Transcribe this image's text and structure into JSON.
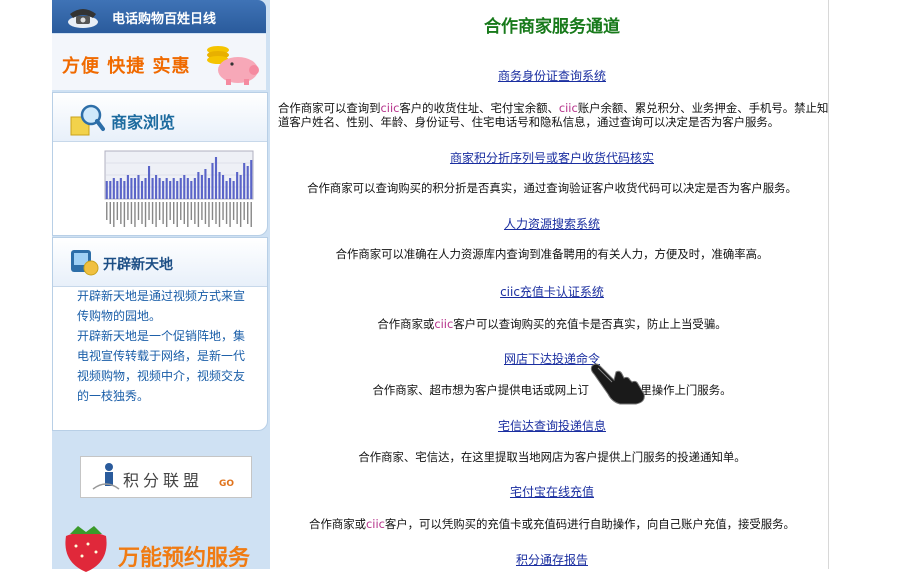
{
  "sidebar": {
    "hotline_title": "电话购物百姓日线",
    "slogan": "方便 快捷 实惠",
    "browse_title": "商家浏览",
    "new_world_title": "开辟新天地",
    "new_world_desc": [
      "开辟新天地是通过视频方式来宣传购物的园地。",
      "开辟新天地是一个促销阵地，集电视宣传转载于网络，是新一代视频购物，视频中介，视频交友的一枝独秀。"
    ],
    "points_alliance": "积分联盟",
    "points_go": "GO",
    "booking_service": "万能预约服务"
  },
  "main": {
    "title": "合作商家服务通道",
    "services": [
      {
        "link": "商务身份证查询系统",
        "desc_parts": [
          "合作商家可以查询到",
          "ciic",
          "客户的收货住址、宅付宝余额、",
          "ciic",
          "账户余额、累兑积分、业务押金、手机号。禁止知道客户姓名、性别、年龄、身份证号、住宅电话号和隐私信息，通过查询可以决定是否为客户服务。"
        ]
      },
      {
        "link": "商家积分折序列号或客户收货代码核实",
        "desc_parts": [
          "合作商家可以查询购买的积分折是否真实，通过查询验证客户收货代码可以决定是否为客户服务。"
        ]
      },
      {
        "link": "人力资源搜索系统",
        "desc_parts": [
          "合作商家可以准确在人力资源库内查询到准备聘用的有关人力，方便及时，准确率高。"
        ]
      },
      {
        "link": "ciic充值卡认证系统",
        "desc_parts": [
          "合作商家或",
          "ciic",
          "客户可以查询购买的充值卡是否真实，防止上当受骗。"
        ]
      },
      {
        "link": "网店下达投递命令",
        "desc_parts": [
          "合作商家、超市想为客户提供电话或网上订",
          "",
          "这里操作上门服务。"
        ]
      },
      {
        "link": "宅信达查询投递信息",
        "desc_parts": [
          "合作商家、宅信达，在这里提取当地网店为客户提供上门服务的投递通知单。"
        ]
      },
      {
        "link": "宅付宝在线充值",
        "desc_parts": [
          "合作商家或",
          "ciic",
          "客户，可以凭购买的充值卡或充值码进行自助操作，向自己账户充值，接受服务。"
        ]
      },
      {
        "link": "积分通存报告",
        "desc_parts": []
      }
    ]
  },
  "chart_data": {
    "type": "bar",
    "values": [
      6,
      6,
      7,
      6,
      7,
      6,
      8,
      7,
      7,
      8,
      6,
      7,
      11,
      7,
      8,
      7,
      6,
      7,
      6,
      7,
      6,
      7,
      8,
      7,
      6,
      7,
      9,
      8,
      10,
      7,
      12,
      14,
      9,
      8,
      6,
      7,
      6,
      9,
      8,
      12,
      11,
      13
    ],
    "ylim": [
      0,
      16
    ]
  },
  "colors": {
    "link": "#1a2ea0",
    "title_green": "#187a1b",
    "ciic_pink": "#b5318a",
    "sidebar_blue": "#cfe1f3",
    "slogan_orange": "#f06a00"
  },
  "icons": [
    "telephone-icon",
    "pig-coins-icon",
    "magnifier-icon",
    "tv-icon",
    "strawberry-icon",
    "hand-cursor-icon"
  ]
}
